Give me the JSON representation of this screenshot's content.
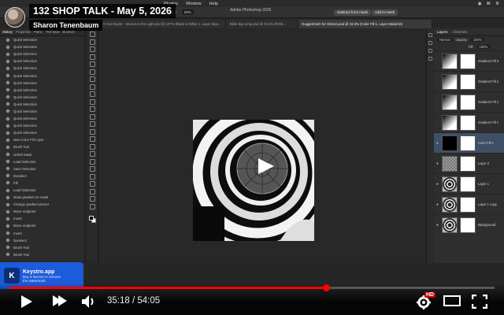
{
  "video": {
    "title": "132 SHOP TALK - May 5, 2026",
    "channel": "Sharon Tenenbaum",
    "progress_fraction": 0.6531
  },
  "player": {
    "current_time": "35:18",
    "separator": "/",
    "duration": "54:05",
    "hd_badge": "HD"
  },
  "photoshop": {
    "menubar": [
      "Plugins",
      "Window",
      "Help"
    ],
    "app_title": "Adobe Photoshop 2026",
    "options": {
      "opacity_label": "Opacity:",
      "opacity_value": "50%",
      "flow_label": "Flow:",
      "flow_value": "100%",
      "smoothing_label": "Smoothing:",
      "smoothing_value": "10%",
      "subtract_mask": "Subtract from mask",
      "add_mask": "Add to mask"
    },
    "doc_tabs": [
      {
        "label": "© Geri Boyle - Stream to the Light.psd @ 107% (Black & White 1, Layer Mas...",
        "active": false
      },
      {
        "label": "Table-leg-comp.psd @ 33.3% (RGB...",
        "active": false
      },
      {
        "label": "Guggenheim for Sharon.psd @ 33.3% (Color Fill 1, Layer Mask/16)",
        "active": true
      }
    ],
    "history_tabs": [
      "History",
      "Properties",
      "Paths",
      "TK8 Multi",
      "Brushes"
    ],
    "history_items": [
      "Quick Selection",
      "Quick Selection",
      "Quick Selection",
      "Quick Selection",
      "Quick Selection",
      "Quick Selection",
      "Quick Selection",
      "Quick Selection",
      "Quick Selection",
      "Quick Selection",
      "Quick Selection",
      "Quick Selection",
      "Quick Selection",
      "Quick Selection",
      "New Color Fill Layer",
      "Brush Tool",
      "Unlink Mask",
      "Load Selection",
      "Save Selection",
      "Deselect",
      "Fill",
      "Load Selection",
      "Draw gradient on mask",
      "Change gradient preset",
      "Move endpoint",
      "Invert",
      "Move endpoint",
      "Invert",
      "Deselect",
      "Brush Tool",
      "Brush Tool"
    ],
    "layers_tabs": [
      "Layers",
      "Channels"
    ],
    "blend_mode": "Normal",
    "blend_opacity_label": "Opacity:",
    "blend_opacity": "100%",
    "fill_label": "Fill:",
    "fill_value": "100%",
    "layers": [
      {
        "name": "Gradient Fill 3",
        "thumb": "grad",
        "selected": false,
        "visible": false
      },
      {
        "name": "Gradient Fill 2",
        "thumb": "grad",
        "selected": false,
        "visible": false
      },
      {
        "name": "Gradient Fill 1",
        "thumb": "grad",
        "selected": false,
        "visible": false
      },
      {
        "name": "Gradient Fill 1",
        "thumb": "grad",
        "selected": false,
        "visible": false
      },
      {
        "name": "Color Fill 1",
        "thumb": "black",
        "selected": true,
        "visible": true
      },
      {
        "name": "Layer 2",
        "thumb": "checker",
        "selected": false,
        "visible": true
      },
      {
        "name": "Layer 1",
        "thumb": "ring",
        "selected": false,
        "visible": true
      },
      {
        "name": "Layer 1 copy",
        "thumb": "ring",
        "selected": false,
        "visible": true
      },
      {
        "name": "Background",
        "thumb": "ring",
        "selected": false,
        "visible": true
      }
    ]
  },
  "watermark": {
    "logo_letter": "K",
    "name": "Keystro.app",
    "line1": "Buy a license to remove",
    "line2": "the watermark."
  },
  "colors": {
    "progress_red": "#ff0000",
    "keystro_blue": "#1c5bd9",
    "layer_selected": "#3f4f66"
  },
  "icons": {
    "play": "play-icon",
    "next": "next-icon",
    "volume": "volume-icon",
    "settings": "gear-icon",
    "theater": "theater-mode-icon",
    "fullscreen": "fullscreen-icon"
  }
}
